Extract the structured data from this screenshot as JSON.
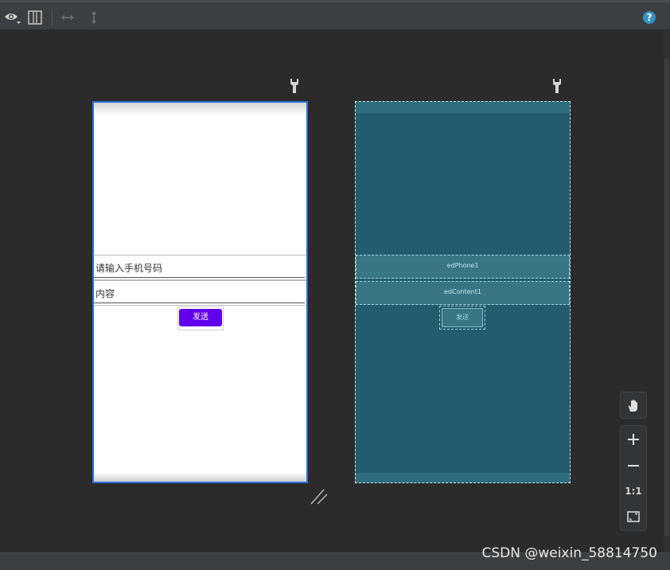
{
  "toolbar": {
    "icons": [
      "eye-dropdown-icon",
      "split-view-icon",
      "horizontal-resize-icon",
      "vertical-resize-icon"
    ],
    "help_label": "?"
  },
  "design_view": {
    "phone_hint": "请输入手机号码",
    "content_hint": "内容",
    "send_label": "发送",
    "button_color": "#6200ee"
  },
  "blueprint_view": {
    "phone_id": "edPhone1",
    "content_id": "edContent1",
    "send_label": "发送"
  },
  "zoom_panel": {
    "actual_size_label": "1:1"
  },
  "watermark": "CSDN @weixin_58814750"
}
